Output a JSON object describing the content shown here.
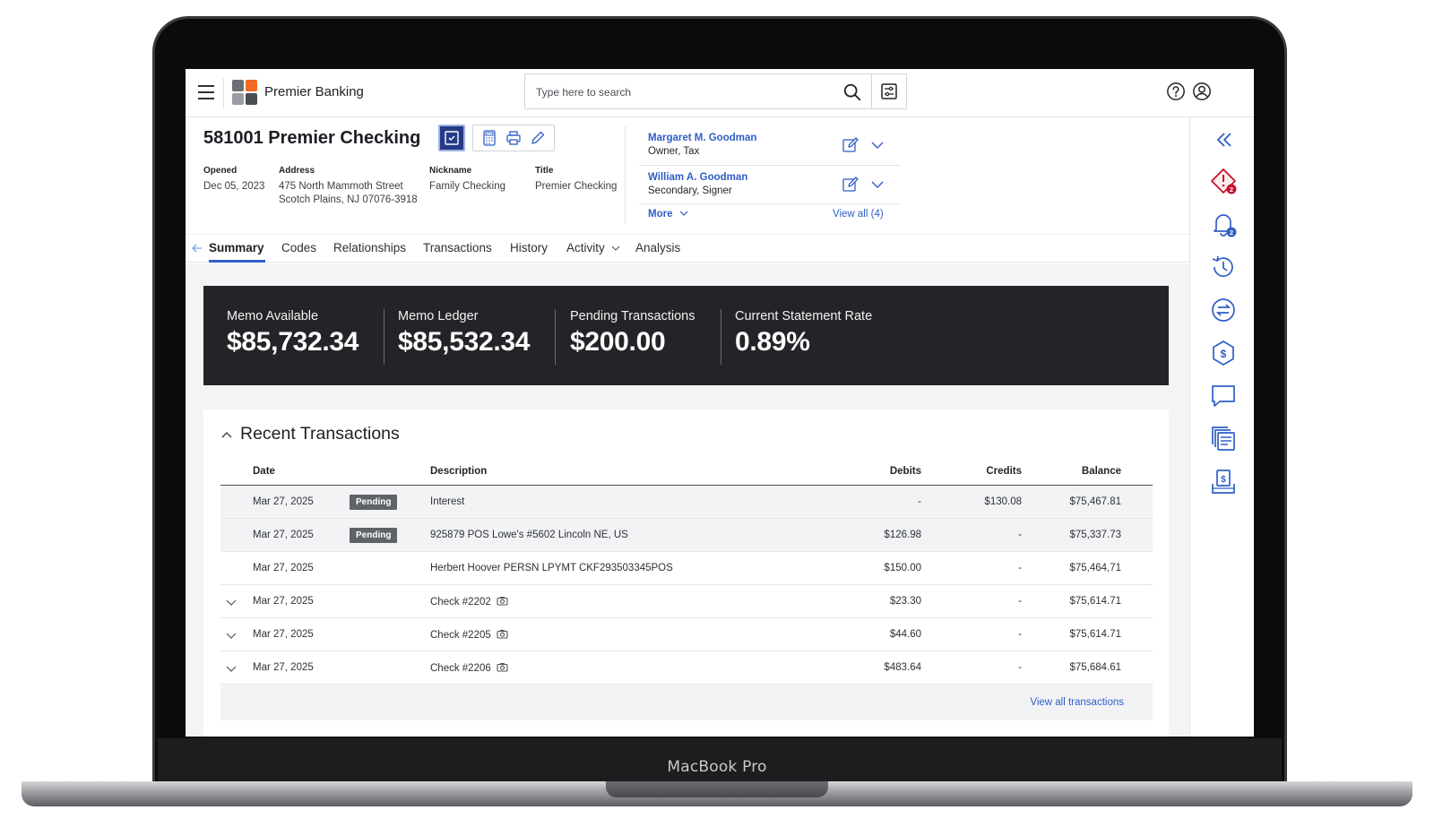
{
  "device": {
    "brand_label": "MacBook Pro"
  },
  "topbar": {
    "brand_name": "Premier Banking",
    "search_placeholder": "Type here to search",
    "logo_colors": [
      "#f06a22",
      "#6b6e73",
      "#9a9da2",
      "#4a4d52"
    ]
  },
  "account": {
    "title": "581001 Premier Checking",
    "fields": [
      {
        "label": "Opened",
        "value": "Dec 05, 2023"
      },
      {
        "label": "Address",
        "value_line1": "475 North Mammoth Street",
        "value_line2": "Scotch Plains, NJ 07076-3918"
      },
      {
        "label": "Nickname",
        "value": "Family Checking"
      },
      {
        "label": "Title",
        "value": "Premier Checking"
      }
    ],
    "people": [
      {
        "name": "Margaret M. Goodman",
        "role": "Owner, Tax"
      },
      {
        "name": "William A. Goodman",
        "role": "Secondary, Signer"
      }
    ],
    "more_label": "More",
    "view_all_label": "View all (4)"
  },
  "tabs": [
    {
      "label": "Summary",
      "active": true
    },
    {
      "label": "Codes"
    },
    {
      "label": "Relationships"
    },
    {
      "label": "Transactions"
    },
    {
      "label": "History"
    },
    {
      "label": "Activity",
      "has_dropdown": true
    },
    {
      "label": "Analysis"
    }
  ],
  "kpis": [
    {
      "label": "Memo Available",
      "value": "$85,732.34"
    },
    {
      "label": "Memo Ledger",
      "value": "$85,532.34"
    },
    {
      "label": "Pending Transactions",
      "value": "$200.00"
    },
    {
      "label": "Current Statement Rate",
      "value": "0.89%"
    }
  ],
  "transactions": {
    "title": "Recent Transactions",
    "columns": [
      "Date",
      "Description",
      "Debits",
      "Credits",
      "Balance"
    ],
    "rows": [
      {
        "date": "Mar 27, 2025",
        "badge": "Pending",
        "description": "Interest",
        "debits": "-",
        "credits": "$130.08",
        "balance": "$75,467.81"
      },
      {
        "date": "Mar 27, 2025",
        "badge": "Pending",
        "description": "925879 POS Lowe's #5602 Lincoln NE, US",
        "debits": "$126.98",
        "credits": "-",
        "balance": "$75,337.73"
      },
      {
        "date": "Mar 27, 2025",
        "description": "Herbert Hoover PERSN LPYMT CKF293503345POS",
        "debits": "$150.00",
        "credits": "-",
        "balance": "$75,464,71"
      },
      {
        "date": "Mar 27, 2025",
        "description": "Check #2202",
        "debits": "$23.30",
        "credits": "-",
        "balance": "$75,614.71"
      },
      {
        "date": "Mar 27, 2025",
        "description": "Check #2205",
        "debits": "$44.60",
        "credits": "-",
        "balance": "$75,614.71"
      },
      {
        "date": "Mar 27, 2025",
        "description": "Check #2206",
        "debits": "$483.64",
        "credits": "-",
        "balance": "$75,684.61"
      }
    ],
    "view_all_label": "View all transactions"
  },
  "rail": {
    "alert_badge": "2",
    "notification_badge": "2",
    "icons": [
      "collapse-icon",
      "alert-icon",
      "bell-icon",
      "history-icon",
      "transfer-icon",
      "dollar-icon",
      "chat-icon",
      "statements-icon",
      "deposit-icon"
    ]
  },
  "colors": {
    "accent": "#2f5ec6",
    "primary_button": "#263b87",
    "banner": "#222427",
    "alert": "#c8102e"
  }
}
